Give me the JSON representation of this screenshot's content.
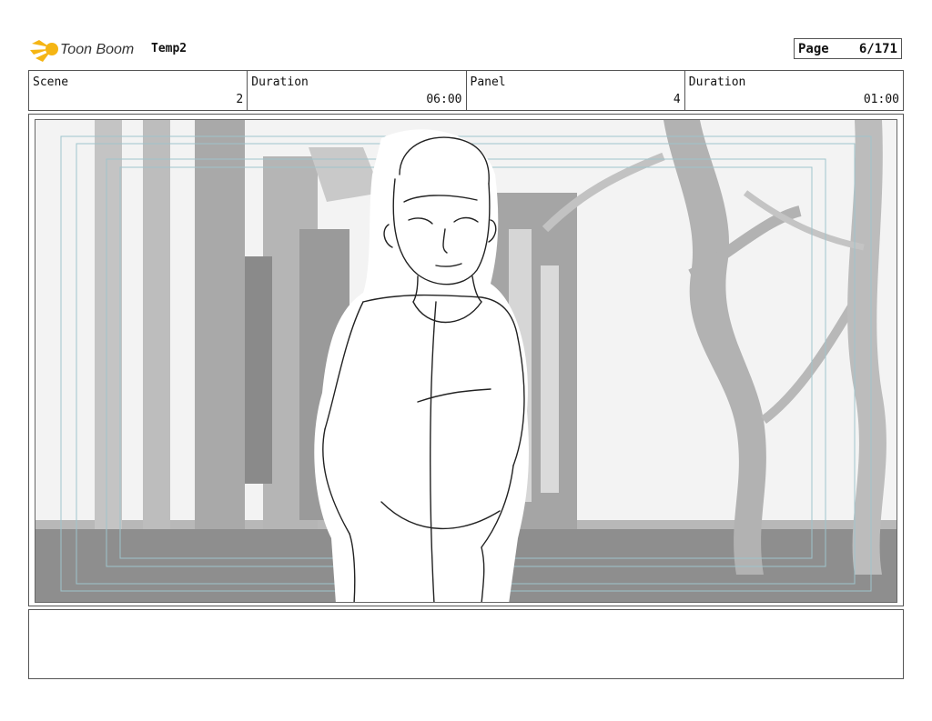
{
  "header": {
    "logo_text": "Toon Boom",
    "project_name": "Temp2",
    "page_label": "Page",
    "page_value": "6/171"
  },
  "info": {
    "scene_label": "Scene",
    "scene_value": "2",
    "scene_duration_label": "Duration",
    "scene_duration_value": "06:00",
    "panel_label": "Panel",
    "panel_value": "4",
    "panel_duration_label": "Duration",
    "panel_duration_value": "01:00"
  },
  "panel": {
    "image_subject": "storyboard-sketch-boy-in-forest-alley"
  },
  "colors": {
    "logo_yellow": "#f5b514",
    "guide_lines": "#9fc4cc"
  }
}
